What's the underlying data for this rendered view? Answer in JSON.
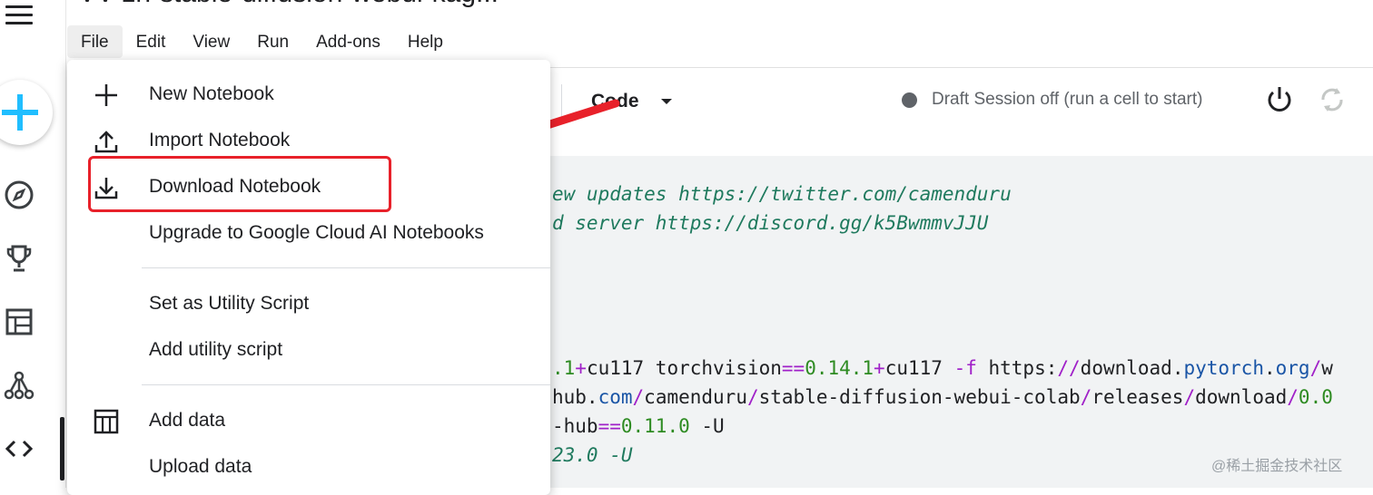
{
  "page": {
    "title": "VV-zh-stable-diffusion-webui-kag..."
  },
  "menubar": {
    "items": [
      "File",
      "Edit",
      "View",
      "Run",
      "Add-ons",
      "Help"
    ]
  },
  "toolbar": {
    "cell_type": "Code",
    "session_status": "Draft Session off (run a cell to start)",
    "status_dot_color": "#5f6368"
  },
  "file_menu": {
    "items": [
      {
        "label": "New Notebook",
        "icon": "plus-icon"
      },
      {
        "label": "Import Notebook",
        "icon": "upload-icon"
      },
      {
        "label": "Download Notebook",
        "icon": "download-icon",
        "highlighted": true
      },
      {
        "label": "Upgrade to Google Cloud AI Notebooks",
        "icon": ""
      },
      {
        "label": "Set as Utility Script",
        "icon": ""
      },
      {
        "label": "Add utility script",
        "icon": ""
      },
      {
        "label": "Add data",
        "icon": "table-icon"
      },
      {
        "label": "Upload data",
        "icon": ""
      }
    ]
  },
  "code": {
    "line1": "ew updates https://twitter.com/camenduru",
    "line2": "d server https://discord.gg/k5BwmmvJJU",
    "line3_parts": [
      ".1",
      "+",
      "cu117 torchvision",
      "==",
      "0.14.1",
      "+",
      "cu117 ",
      "-f",
      " https:",
      "//",
      "download.",
      "pytorch",
      ".",
      "org",
      "/",
      "w"
    ],
    "line4_parts": [
      "hub.",
      "com",
      "/",
      "camenduru",
      "/",
      "stable-diffusion-webui-colab",
      "/",
      "releases",
      "/",
      "download",
      "/",
      "0.0"
    ],
    "line5_parts": [
      "-hub",
      "==",
      "0.11.0",
      " -U"
    ],
    "line6": "23.0 -U"
  },
  "watermark": "@稀土掘金技术社区",
  "colors": {
    "annotation_red": "#e8212a",
    "comment_green": "#1f7a5e",
    "number_green": "#2e8b22",
    "operator_purple": "#a020c8",
    "url_blue": "#1a55a6"
  }
}
